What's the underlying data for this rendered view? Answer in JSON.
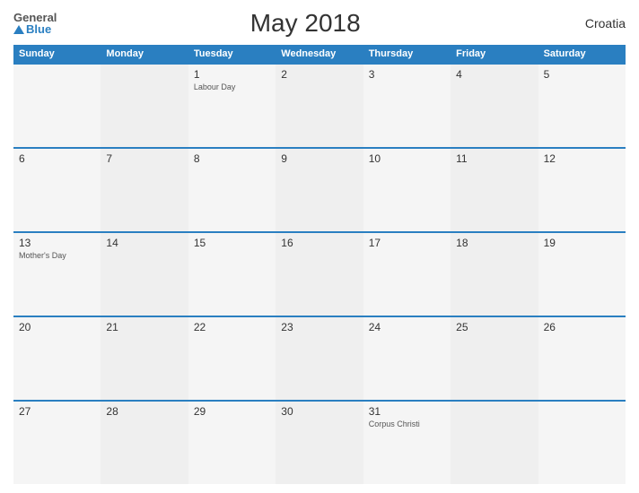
{
  "header": {
    "logo_general": "General",
    "logo_blue": "Blue",
    "title": "May 2018",
    "country": "Croatia"
  },
  "calendar": {
    "days_of_week": [
      "Sunday",
      "Monday",
      "Tuesday",
      "Wednesday",
      "Thursday",
      "Friday",
      "Saturday"
    ],
    "weeks": [
      [
        {
          "day": "",
          "event": ""
        },
        {
          "day": "",
          "event": ""
        },
        {
          "day": "1",
          "event": "Labour Day"
        },
        {
          "day": "2",
          "event": ""
        },
        {
          "day": "3",
          "event": ""
        },
        {
          "day": "4",
          "event": ""
        },
        {
          "day": "5",
          "event": ""
        }
      ],
      [
        {
          "day": "6",
          "event": ""
        },
        {
          "day": "7",
          "event": ""
        },
        {
          "day": "8",
          "event": ""
        },
        {
          "day": "9",
          "event": ""
        },
        {
          "day": "10",
          "event": ""
        },
        {
          "day": "11",
          "event": ""
        },
        {
          "day": "12",
          "event": ""
        }
      ],
      [
        {
          "day": "13",
          "event": "Mother's Day"
        },
        {
          "day": "14",
          "event": ""
        },
        {
          "day": "15",
          "event": ""
        },
        {
          "day": "16",
          "event": ""
        },
        {
          "day": "17",
          "event": ""
        },
        {
          "day": "18",
          "event": ""
        },
        {
          "day": "19",
          "event": ""
        }
      ],
      [
        {
          "day": "20",
          "event": ""
        },
        {
          "day": "21",
          "event": ""
        },
        {
          "day": "22",
          "event": ""
        },
        {
          "day": "23",
          "event": ""
        },
        {
          "day": "24",
          "event": ""
        },
        {
          "day": "25",
          "event": ""
        },
        {
          "day": "26",
          "event": ""
        }
      ],
      [
        {
          "day": "27",
          "event": ""
        },
        {
          "day": "28",
          "event": ""
        },
        {
          "day": "29",
          "event": ""
        },
        {
          "day": "30",
          "event": ""
        },
        {
          "day": "31",
          "event": "Corpus Christi"
        },
        {
          "day": "",
          "event": ""
        },
        {
          "day": "",
          "event": ""
        }
      ]
    ]
  }
}
